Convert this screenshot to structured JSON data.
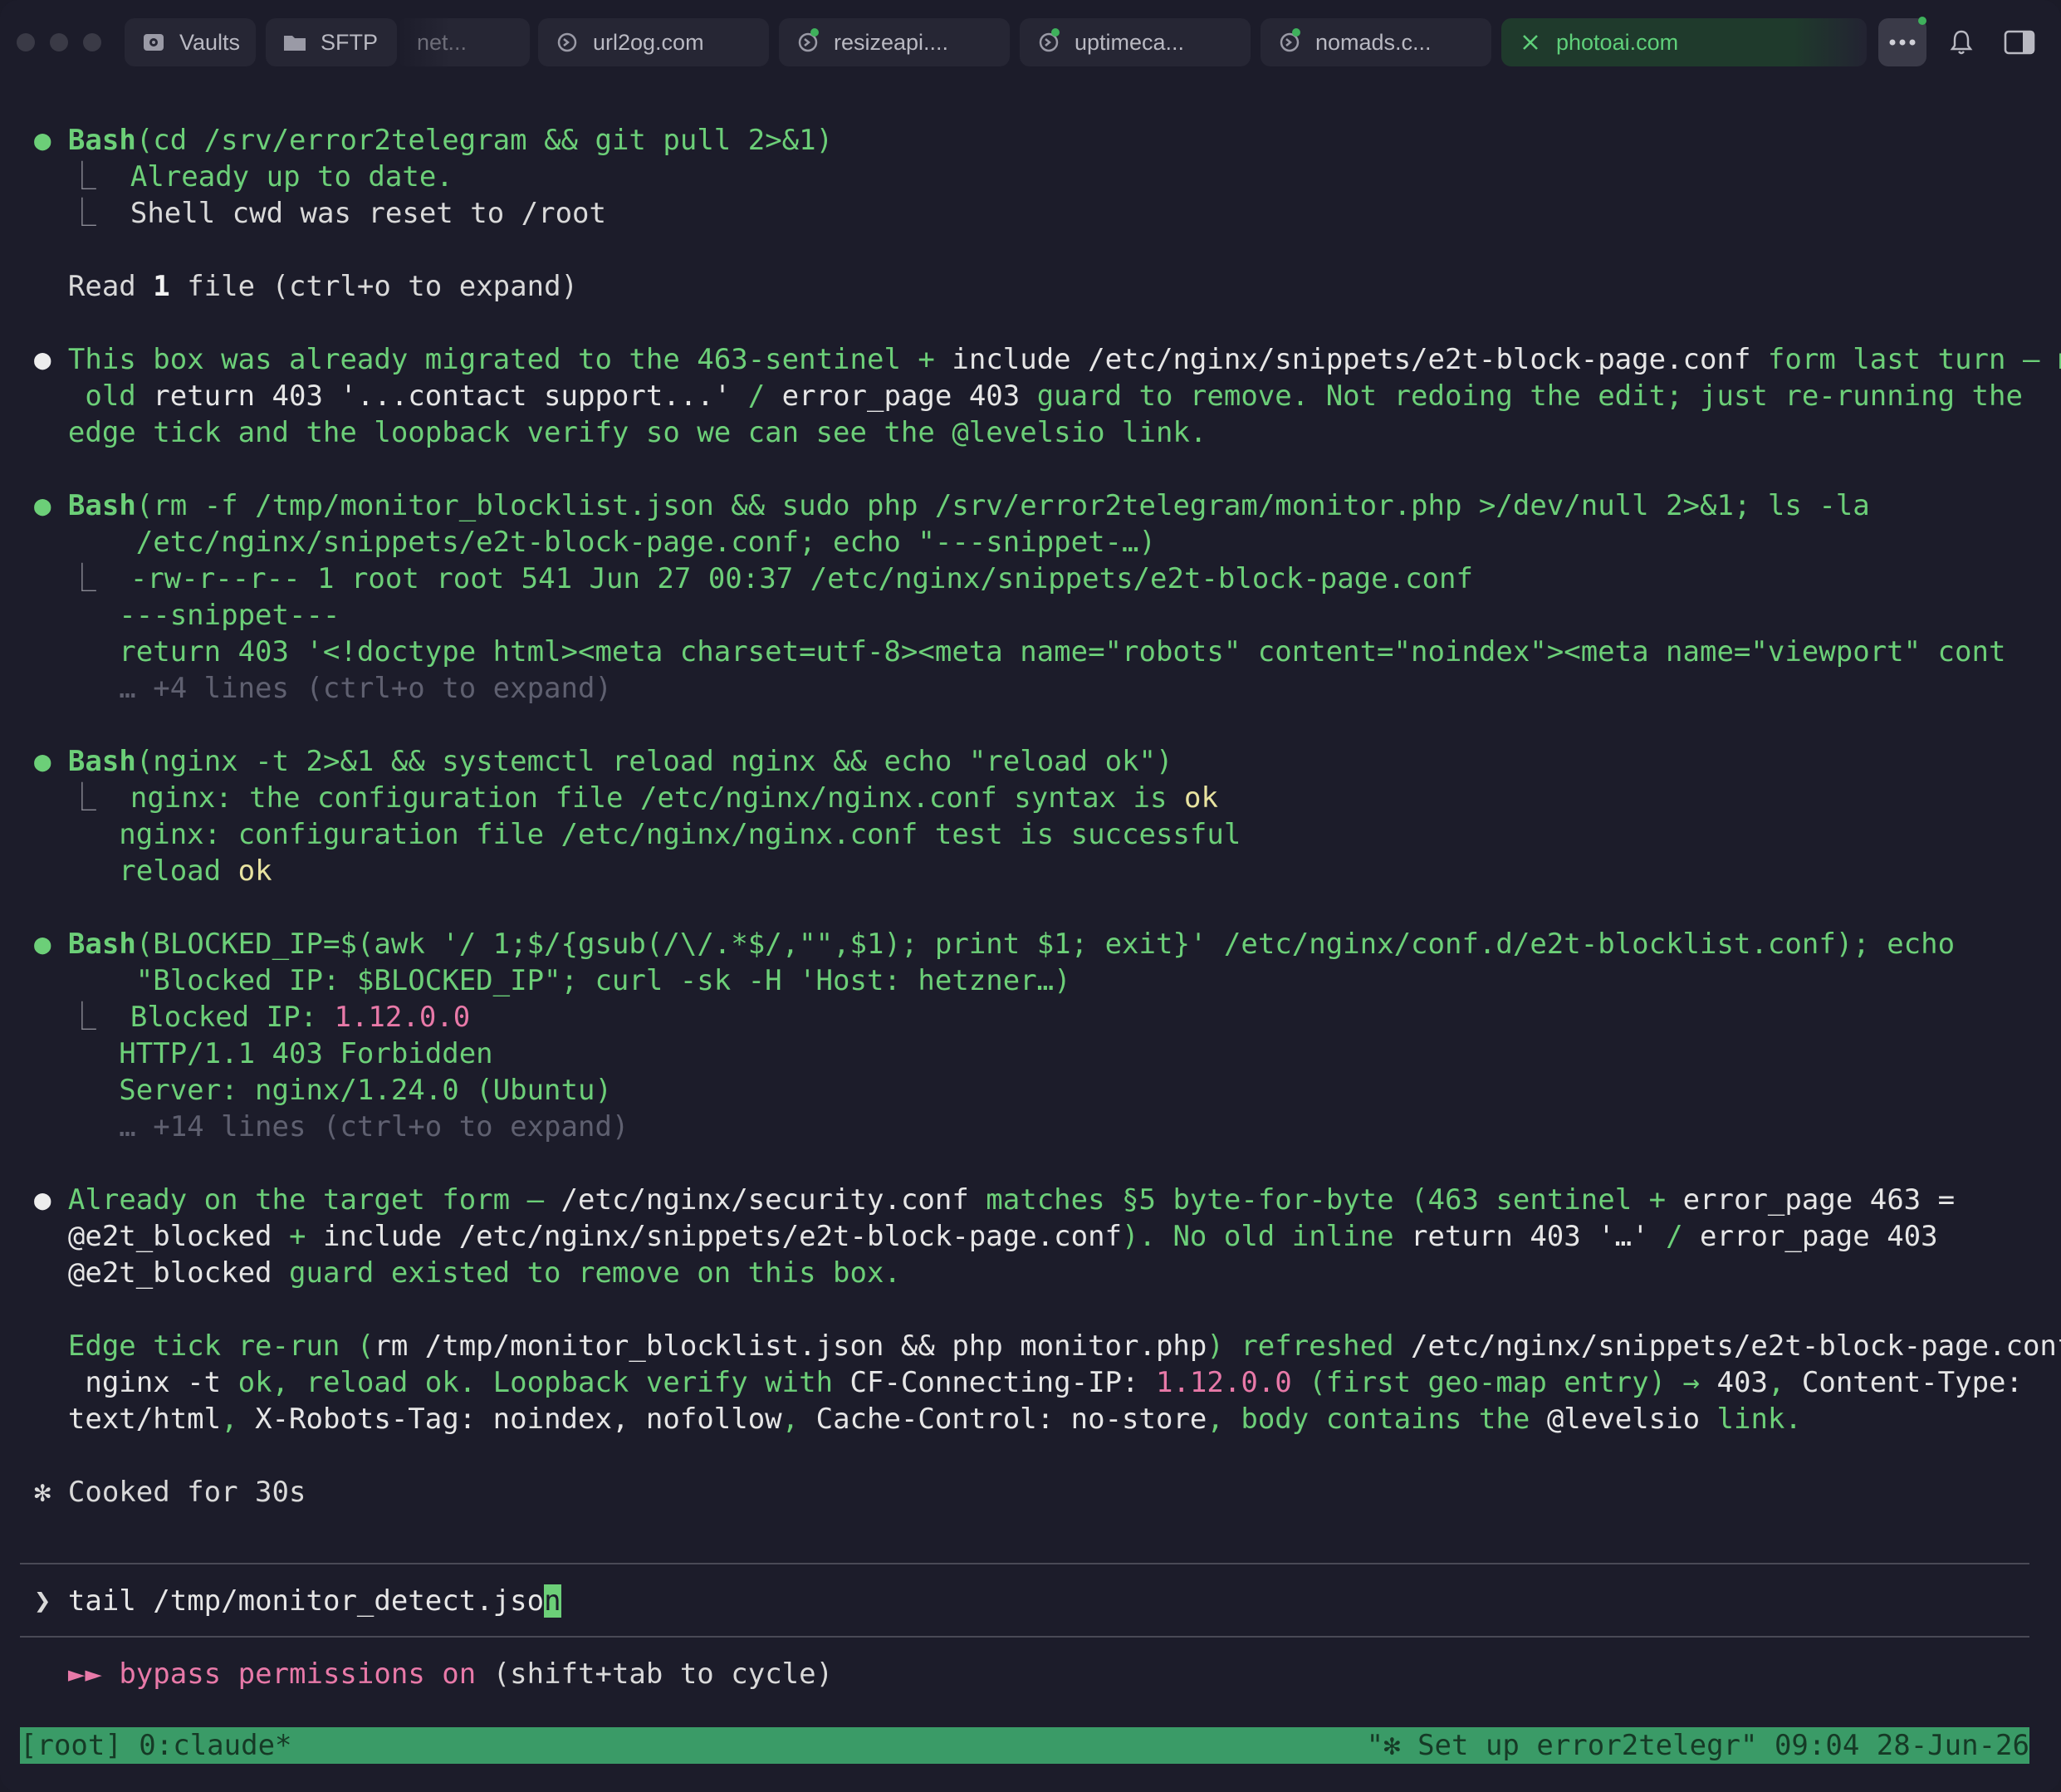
{
  "tabs": [
    {
      "label": "Vaults",
      "icon": "vault-icon"
    },
    {
      "label": "SFTP",
      "icon": "folder-icon"
    },
    {
      "label": "net...",
      "icon": "none"
    },
    {
      "label": "url2og.com",
      "icon": "terminal-icon"
    },
    {
      "label": "resizeapi....",
      "icon": "terminal-icon"
    },
    {
      "label": "uptimeca...",
      "icon": "terminal-icon"
    },
    {
      "label": "nomads.c...",
      "icon": "terminal-icon"
    },
    {
      "label": "photoai.com",
      "icon": "close-icon"
    }
  ],
  "terminal": {
    "b1": {
      "tool": "Bash",
      "args": "(cd /srv/error2telegram && git pull 2>&1)",
      "out1": "Already up to date.",
      "out2": "Shell cwd was reset to /root"
    },
    "read": {
      "pre": "Read ",
      "count": "1",
      "post": " file (ctrl+o to expand)"
    },
    "m1": {
      "l1a": "This box was already migrated to the 463-sentinel + ",
      "l1b": "include /etc/nginx/snippets/e2t-block-page.conf",
      "l1c": " form last turn — no",
      "l2a": "old ",
      "l2b": "return 403 '...contact support...'",
      "l2c": " / ",
      "l2d": "error_page 403",
      "l2e": " guard to remove. Not redoing the edit; just re-running the",
      "l3": "edge tick and the loopback verify so we can see the @levelsio link."
    },
    "b2": {
      "tool": "Bash",
      "args1": "(rm -f /tmp/monitor_blocklist.json && sudo php /srv/error2telegram/monitor.php >/dev/null 2>&1; ls -la",
      "args2": "/etc/nginx/snippets/e2t-block-page.conf; echo \"---snippet-…)",
      "out1": "-rw-r--r-- 1 root root 541 Jun 27 00:37 /etc/nginx/snippets/e2t-block-page.conf",
      "out2": "---snippet---",
      "out3": "return 403 '<!doctype html><meta charset=utf-8><meta name=\"robots\" content=\"noindex\"><meta name=\"viewport\" cont",
      "more": "… +4 lines (ctrl+o to expand)"
    },
    "b3": {
      "tool": "Bash",
      "args": "(nginx -t 2>&1 && systemctl reload nginx && echo \"reload ok\")",
      "out1a": "nginx: the configuration file /etc/nginx/nginx.conf syntax is ",
      "out1b": "ok",
      "out2": "nginx: configuration file /etc/nginx/nginx.conf test is successful",
      "out3a": "reload ",
      "out3b": "ok"
    },
    "b4": {
      "tool": "Bash",
      "args1": "(BLOCKED_IP=$(awk '/ 1;$/{gsub(/\\/.*$/,\"\",$1); print $1; exit}' /etc/nginx/conf.d/e2t-blocklist.conf); echo",
      "args2": "\"Blocked IP: $BLOCKED_IP\"; curl -sk -H 'Host: hetzner…)",
      "out1a": "Blocked IP: ",
      "out1b": "1.12.0.0",
      "out2": "HTTP/1.1 403 Forbidden",
      "out3": "Server: nginx/1.24.0 (Ubuntu)",
      "more": "… +14 lines (ctrl+o to expand)"
    },
    "m2": {
      "l1a": "Already on the target form — ",
      "l1b": "/etc/nginx/security.conf",
      "l1c": " matches §5 byte-for-byte (",
      "l1d": "463",
      "l1e": " sentinel + ",
      "l1f": "error_page 463 =",
      "l2a": "@e2t_blocked",
      "l2b": " + ",
      "l2c": "include /etc/nginx/snippets/e2t-block-page.conf",
      "l2d": "). No old inline ",
      "l2e": "return 403 '…'",
      "l2f": " / ",
      "l2g": "error_page 403",
      "l3a": "@e2t_blocked",
      "l3b": " guard existed to remove on this box.",
      "p1a": "Edge tick re-run (",
      "p1b": "rm /tmp/monitor_blocklist.json && php monitor.php",
      "p1c": ") refreshed ",
      "p1d": "/etc/nginx/snippets/e2t-block-page.conf",
      "p1e": ".",
      "p2a": " nginx -t",
      "p2b": " ok, reload ok. Loopback verify with ",
      "p2c": "CF-Connecting-IP: ",
      "p2d": "1.12.0.0",
      "p2e": " (first geo-map entry) → ",
      "p2f": "403",
      "p2g": ", ",
      "p2h": "Content-Type:",
      "p3a": "text/html",
      "p3b": ", ",
      "p3c": "X-Robots-Tag: noindex, nofollow",
      "p3d": ", ",
      "p3e": "Cache-Control: no-store",
      "p3f": ", body contains the ",
      "p3g": "@levelsio",
      "p3h": " link."
    },
    "cooked": "✻ Cooked for 30s",
    "prompt": {
      "symbol": "❯",
      "before": "tail /tmp/monitor_detect.jso",
      "cursor_char": "n"
    },
    "mode": {
      "arrows": "►►",
      "label": "bypass permissions on",
      "hint": " (shift+tab to cycle)"
    },
    "statusbar": {
      "left": "[root] 0:claude*",
      "right": "\"✻ Set up error2telegr\" 09:04 28-Jun-26"
    }
  },
  "colors": {
    "accent_green": "#6ccf78",
    "status_green": "#3a9b67",
    "ip_pink": "#e879a8",
    "background": "#1c1c2a"
  }
}
